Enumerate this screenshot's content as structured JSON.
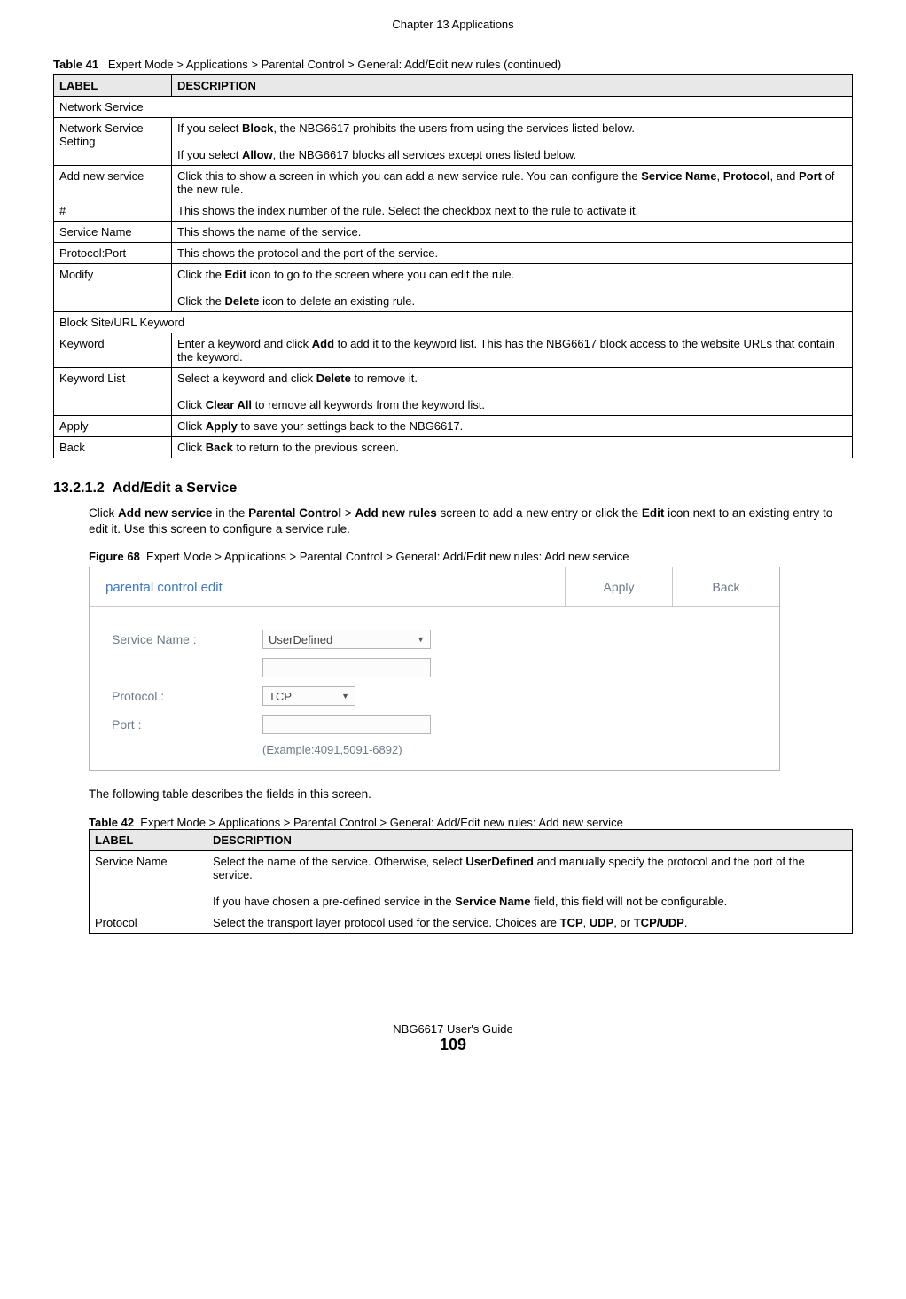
{
  "header": {
    "chapter": "Chapter 13 Applications"
  },
  "table41": {
    "caption_num": "Table 41",
    "caption_text": "Expert Mode > Applications > Parental Control > General: Add/Edit new rules (continued)",
    "col_label": "LABEL",
    "col_desc": "DESCRIPTION",
    "section1": "Network Service",
    "r1_label": "Network Service Setting",
    "r1_desc_a": "If you select ",
    "r1_desc_b": "Block",
    "r1_desc_c": ", the NBG6617 prohibits the users from using the services listed below.",
    "r1_desc_d": "If you select ",
    "r1_desc_e": "Allow",
    "r1_desc_f": ", the NBG6617 blocks all services except ones listed below.",
    "r2_label": "Add new service",
    "r2_a": "Click this to show a screen in which you can add a new service rule. You can configure the ",
    "r2_b": "Service Name",
    "r2_c": ", ",
    "r2_d": "Protocol",
    "r2_e": ", and ",
    "r2_f": "Port",
    "r2_g": " of the new rule.",
    "r3_label": "#",
    "r3_desc": "This shows the index number of the rule. Select the checkbox next to the rule to activate it.",
    "r4_label": "Service Name",
    "r4_desc": "This shows the name of the service.",
    "r5_label": "Protocol:Port",
    "r5_desc": "This shows the protocol and the port of the service.",
    "r6_label": "Modify",
    "r6_a": "Click the ",
    "r6_b": "Edit",
    "r6_c": " icon to go to the screen where you can edit the rule.",
    "r6_d": "Click the ",
    "r6_e": "Delete",
    "r6_f": " icon to delete an existing rule.",
    "section2": "Block Site/URL Keyword",
    "r7_label": "Keyword",
    "r7_a": "Enter a keyword and click ",
    "r7_b": "Add",
    "r7_c": " to add it to the keyword list. This has the NBG6617 block access to the website URLs that contain the keyword.",
    "r8_label": "Keyword List",
    "r8_a": "Select a keyword and click ",
    "r8_b": "Delete",
    "r8_c": " to remove it.",
    "r8_d": "Click ",
    "r8_e": "Clear All",
    "r8_f": " to remove all keywords from the keyword list.",
    "r9_label": "Apply",
    "r9_a": "Click ",
    "r9_b": "Apply",
    "r9_c": " to save your settings back to the NBG6617.",
    "r10_label": "Back",
    "r10_a": "Click ",
    "r10_b": "Back",
    "r10_c": " to return to the previous screen."
  },
  "section": {
    "num": "13.2.1.2",
    "title": "Add/Edit a Service",
    "p1_a": "Click ",
    "p1_b": "Add new service",
    "p1_c": " in the ",
    "p1_d": "Parental Control",
    "p1_e": " > ",
    "p1_f": "Add new rules",
    "p1_g": " screen to add a new entry or click the ",
    "p1_h": "Edit",
    "p1_i": " icon next to an existing entry to edit it. Use this screen to configure a service rule.",
    "p2": "The following table describes the fields in this screen."
  },
  "figure68": {
    "num": "Figure 68",
    "caption": "Expert Mode > Applications > Parental Control > General: Add/Edit new rules: Add new service",
    "title": "parental control edit",
    "btn_apply": "Apply",
    "btn_back": "Back",
    "label_service": "Service Name :",
    "val_service": "UserDefined",
    "label_protocol": "Protocol :",
    "val_protocol": "TCP",
    "label_port": "Port :",
    "example": "(Example:4091,5091-6892)"
  },
  "table42": {
    "caption_num": "Table 42",
    "caption_text": "Expert Mode > Applications > Parental Control > General: Add/Edit new rules: Add new service",
    "col_label": "LABEL",
    "col_desc": "DESCRIPTION",
    "r1_label": "Service Name",
    "r1_a": "Select the name of the service. Otherwise, select ",
    "r1_b": "UserDefined",
    "r1_c": " and manually specify the protocol and the port of the service.",
    "r1_d": "If you have chosen a pre-defined service in the ",
    "r1_e": "Service Name",
    "r1_f": " field, this field will not be configurable.",
    "r2_label": "Protocol",
    "r2_a": "Select the transport layer protocol used for the service. Choices are ",
    "r2_b": "TCP",
    "r2_c": ", ",
    "r2_d": "UDP",
    "r2_e": ", or ",
    "r2_f": "TCP/UDP",
    "r2_g": "."
  },
  "footer": {
    "guide": "NBG6617 User's Guide",
    "page": "109"
  }
}
